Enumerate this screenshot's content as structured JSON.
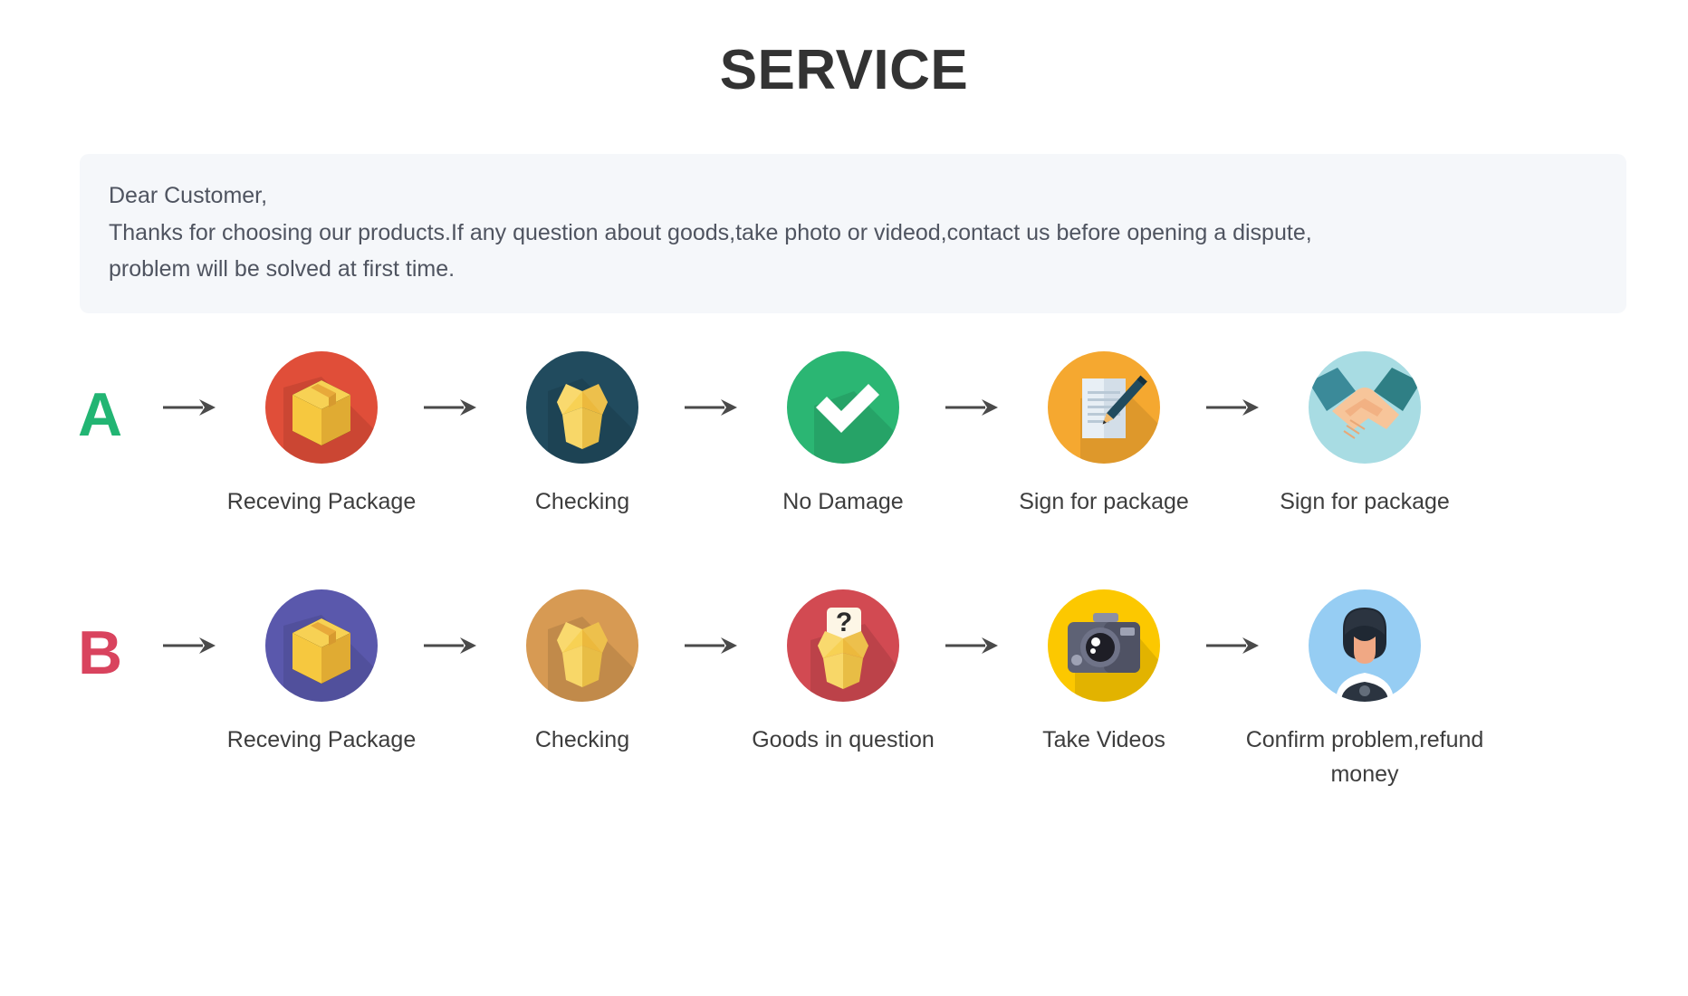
{
  "header": {
    "title": "SERVICE"
  },
  "notice": {
    "line1": "Dear Customer,",
    "line2": "Thanks for choosing our products.If any question about goods,take photo or videod,contact us before opening a dispute,",
    "line3": "problem will be solved at first time."
  },
  "colors": {
    "title": "#333333",
    "notice_bg": "#f5f7fa",
    "notice_text": "#4f5460",
    "letter_a": "#22b573",
    "letter_b": "#d9435e",
    "arrow": "#4a4a4a",
    "label": "#3d3d3d"
  },
  "rows": [
    {
      "letter": "A",
      "letter_color": "#22b573",
      "steps": [
        {
          "label": "Receving Package",
          "icon": "package-box-icon",
          "circle_color": "#e04e39"
        },
        {
          "label": "Checking",
          "icon": "open-box-icon",
          "circle_color": "#214b5e"
        },
        {
          "label": "No Damage",
          "icon": "check-mark-icon",
          "circle_color": "#2bb673"
        },
        {
          "label": "Sign for package",
          "icon": "document-pen-icon",
          "circle_color": "#f5a830"
        },
        {
          "label": "Sign for package",
          "icon": "handshake-icon",
          "circle_color": "#a8dce3"
        }
      ]
    },
    {
      "letter": "B",
      "letter_color": "#d9435e",
      "steps": [
        {
          "label": "Receving Package",
          "icon": "package-box-icon",
          "circle_color": "#5a58ac"
        },
        {
          "label": "Checking",
          "icon": "open-box-icon",
          "circle_color": "#d79a53"
        },
        {
          "label": "Goods in question",
          "icon": "question-box-icon",
          "circle_color": "#d24a52"
        },
        {
          "label": "Take Videos",
          "icon": "camera-icon",
          "circle_color": "#fcc800"
        },
        {
          "label": "Confirm problem,refund money",
          "icon": "support-person-icon",
          "circle_color": "#96cdf3"
        }
      ]
    }
  ]
}
